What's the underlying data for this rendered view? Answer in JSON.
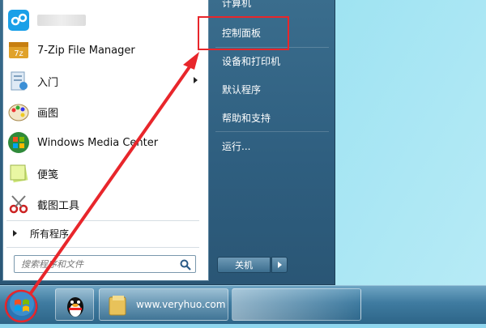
{
  "left_pane": {
    "apps": [
      {
        "label": "",
        "icon": "app-blurred-icon"
      },
      {
        "label": "7-Zip File Manager",
        "icon": "7zip-icon"
      },
      {
        "label": "入门",
        "icon": "getting-started-icon",
        "has_submenu": true
      },
      {
        "label": "画图",
        "icon": "paint-icon"
      },
      {
        "label": "Windows Media Center",
        "icon": "windows-media-center-icon"
      },
      {
        "label": "便笺",
        "icon": "sticky-notes-icon"
      },
      {
        "label": "截图工具",
        "icon": "snipping-tool-icon"
      }
    ],
    "all_programs": "所有程序",
    "search_placeholder": "搜索程序和文件"
  },
  "right_pane": {
    "items": [
      {
        "label": "计算机"
      },
      {
        "label": "控制面板"
      },
      {
        "label": "设备和打印机"
      },
      {
        "label": "默认程序"
      },
      {
        "label": "帮助和支持"
      },
      {
        "label": "运行..."
      }
    ],
    "shutdown_label": "关机"
  },
  "taskbar": {
    "folder_button_label": "www.veryhuo.com"
  },
  "colors": {
    "highlight": "#e8262b",
    "start_menu_bg": "#2f5f80",
    "taskbar_bg": "#3f7ba0"
  }
}
